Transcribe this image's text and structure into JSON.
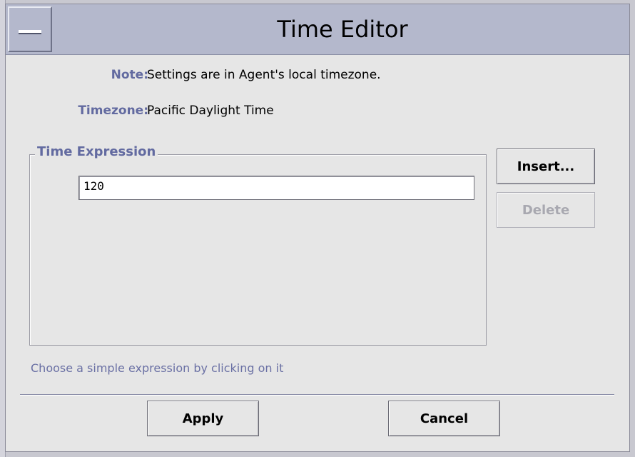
{
  "window": {
    "title": "Time Editor"
  },
  "info": {
    "note_label": "Note:",
    "note_value": "Settings are in Agent's local timezone.",
    "timezone_label": "Timezone:",
    "timezone_value": "Pacific Daylight Time"
  },
  "expression": {
    "group_title": "Time Expression",
    "input_value": "120",
    "insert_label": "Insert...",
    "delete_label": "Delete",
    "hint": "Choose a simple expression by clicking on it"
  },
  "footer": {
    "apply_label": "Apply",
    "cancel_label": "Cancel"
  }
}
